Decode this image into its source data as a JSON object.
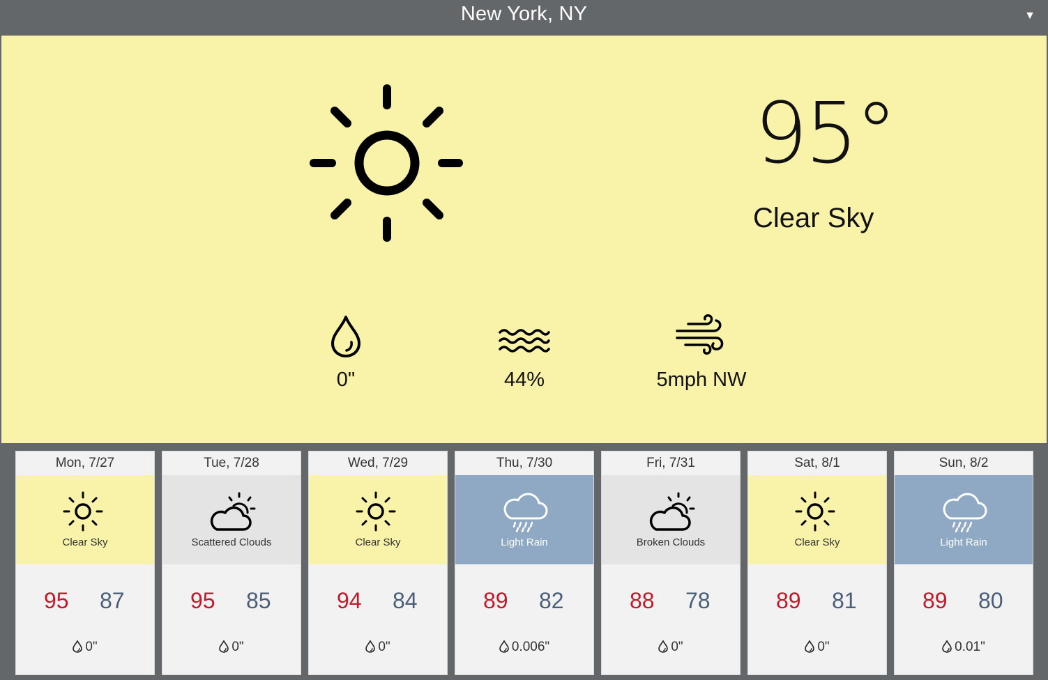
{
  "header": {
    "location": "New York, NY",
    "dropdown_glyph": "▼"
  },
  "current": {
    "icon": "sun-icon",
    "temperature": "95°",
    "condition": "Clear Sky",
    "precipitation": "0\"",
    "humidity": "44%",
    "wind": "5mph NW",
    "background_color": "#f8f3a8"
  },
  "forecast": [
    {
      "day": "Mon, 7/27",
      "icon": "sun-icon",
      "condition": "Clear Sky",
      "high": "95",
      "low": "87",
      "precip": "0\"",
      "bg": "#f8f3a8"
    },
    {
      "day": "Tue, 7/28",
      "icon": "partly-cloudy-icon",
      "condition": "Scattered Clouds",
      "high": "95",
      "low": "85",
      "precip": "0\"",
      "bg": "#e4e4e4"
    },
    {
      "day": "Wed, 7/29",
      "icon": "sun-icon",
      "condition": "Clear Sky",
      "high": "94",
      "low": "84",
      "precip": "0\"",
      "bg": "#f8f3a8"
    },
    {
      "day": "Thu, 7/30",
      "icon": "rain-cloud-icon",
      "condition": "Light Rain",
      "high": "89",
      "low": "82",
      "precip": "0.006\"",
      "bg": "#8fa9c4"
    },
    {
      "day": "Fri, 7/31",
      "icon": "partly-cloudy-icon",
      "condition": "Broken Clouds",
      "high": "88",
      "low": "78",
      "precip": "0\"",
      "bg": "#e4e4e4"
    },
    {
      "day": "Sat, 8/1",
      "icon": "sun-icon",
      "condition": "Clear Sky",
      "high": "89",
      "low": "81",
      "precip": "0\"",
      "bg": "#f8f3a8"
    },
    {
      "day": "Sun, 8/2",
      "icon": "rain-cloud-icon",
      "condition": "Light Rain",
      "high": "89",
      "low": "80",
      "precip": "0.01\"",
      "bg": "#8fa9c4"
    }
  ],
  "colors": {
    "high_temp": "#bf1b2c",
    "low_temp": "#4a5e78",
    "header_bg": "#63676a"
  }
}
